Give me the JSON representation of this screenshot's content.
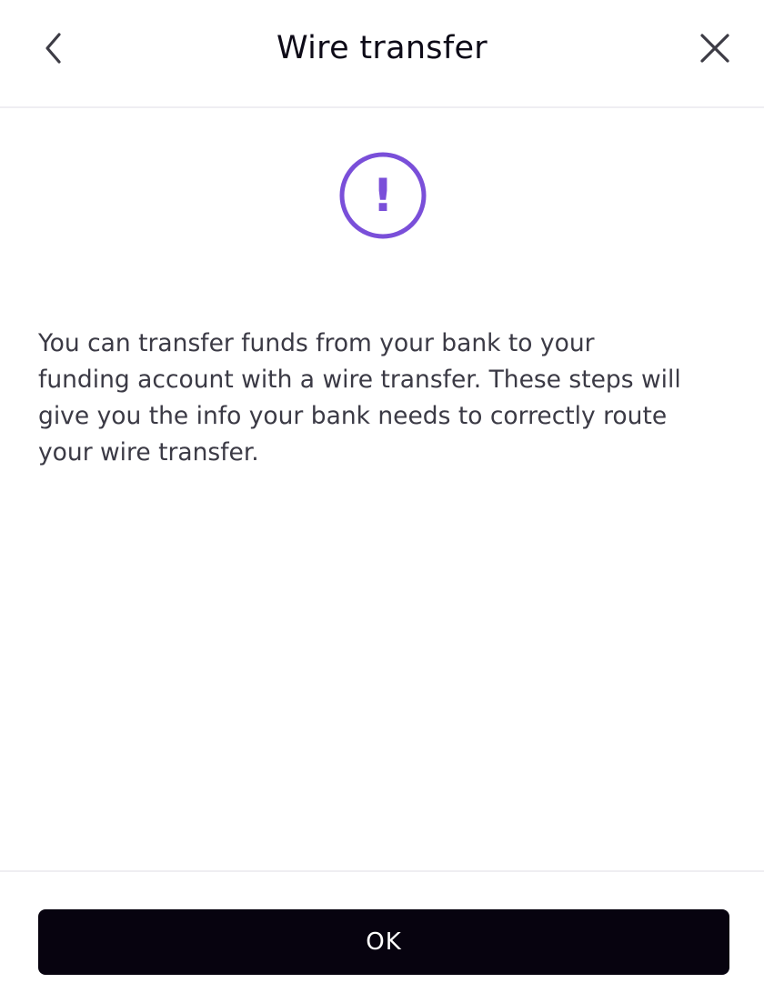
{
  "header": {
    "title": "Wire transfer",
    "back_icon": "chevron-left-icon",
    "close_icon": "close-icon"
  },
  "alert": {
    "icon": "exclamation-circle-icon",
    "glyph": "!",
    "color": "#7a4fd9"
  },
  "message": {
    "text": "You can transfer funds from your bank to your funding account with a wire transfer. These steps will give you the info your bank needs to correctly route your wire transfer."
  },
  "footer": {
    "ok_label": "OK"
  },
  "colors": {
    "text_primary": "#0d0a17",
    "text_body": "#3b3a45",
    "button_bg": "#07030f",
    "divider": "#efeef2"
  }
}
